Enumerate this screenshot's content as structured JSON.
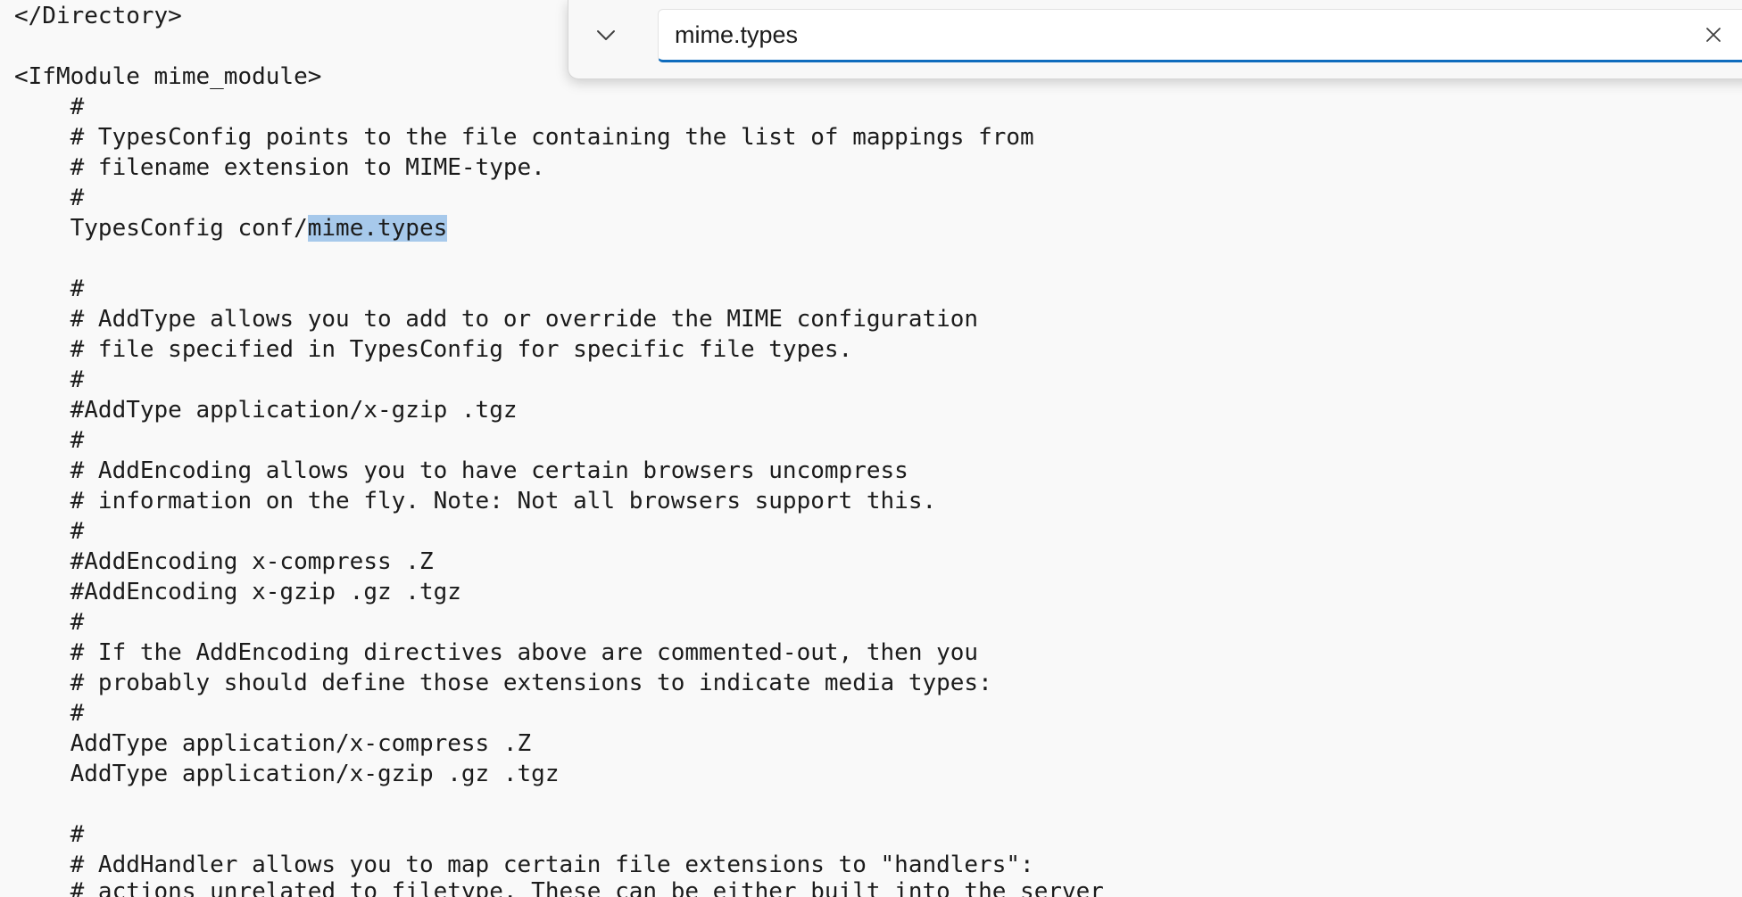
{
  "editor": {
    "lines": [
      "</Directory>",
      "",
      "<IfModule mime_module>",
      "    #",
      "    # TypesConfig points to the file containing the list of mappings from",
      "    # filename extension to MIME-type.",
      "    #",
      "    TypesConfig conf/",
      "",
      "    #",
      "    # AddType allows you to add to or override the MIME configuration",
      "    # file specified in TypesConfig for specific file types.",
      "    #",
      "    #AddType application/x-gzip .tgz",
      "    #",
      "    # AddEncoding allows you to have certain browsers uncompress",
      "    # information on the fly. Note: Not all browsers support this.",
      "    #",
      "    #AddEncoding x-compress .Z",
      "    #AddEncoding x-gzip .gz .tgz",
      "    #",
      "    # If the AddEncoding directives above are commented-out, then you",
      "    # probably should define those extensions to indicate media types:",
      "    #",
      "    AddType application/x-compress .Z",
      "    AddType application/x-gzip .gz .tgz",
      "",
      "    #",
      "    # AddHandler allows you to map certain file extensions to \"handlers\":",
      "    # actions unrelated to filetype. These can be either built into the server"
    ],
    "highlighted_match": "mime.types"
  },
  "find": {
    "query": "mime.types",
    "toggle_icon": "chevron-down-icon",
    "clear_icon": "close-icon"
  },
  "colors": {
    "background": "#f9f9f9",
    "selection": "#a7c9eb",
    "accent": "#0f6cbd",
    "text": "#1b1b1b"
  }
}
